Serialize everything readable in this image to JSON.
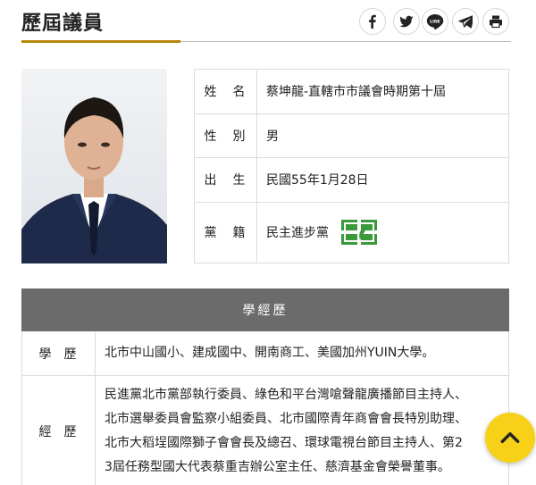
{
  "page": {
    "title": "歷屆議員"
  },
  "share": {
    "icons": [
      "facebook-icon",
      "twitter-icon",
      "line-icon",
      "telegram-icon",
      "print-icon"
    ],
    "line_text": "LINE"
  },
  "profile": {
    "rows": [
      {
        "label": "姓　名",
        "value": "蔡坤龍-直轄市市議會時期第十屆"
      },
      {
        "label": "性　別",
        "value": "男"
      },
      {
        "label": "出　生",
        "value": "民國55年1月28日"
      },
      {
        "label": "黨　籍",
        "value": "民主進步黨"
      }
    ]
  },
  "background": {
    "header": "學經歷",
    "education": {
      "label": "學歷",
      "value": "北市中山國小、建成國中、開南商工、美國加州YUIN大學。"
    },
    "experience": {
      "label": "經歷",
      "lines": [
        "民進黨北市黨部執行委員、綠色和平台灣嗆聲龍廣播節目主持人、",
        "北市選舉委員會監察小組委員、北市國際青年商會會長特別助理、",
        "北市大稻埕國際獅子會會長及總召、環球電視台節目主持人、第2",
        "3屆任務型國大代表蔡重吉辦公室主任、慈濟基金會榮譽董事。"
      ]
    }
  },
  "colors": {
    "accent": "#b8860b",
    "table_header": "#6b6b6b",
    "scroll_button": "#f7d117",
    "party_green": "#3a9a3a"
  }
}
